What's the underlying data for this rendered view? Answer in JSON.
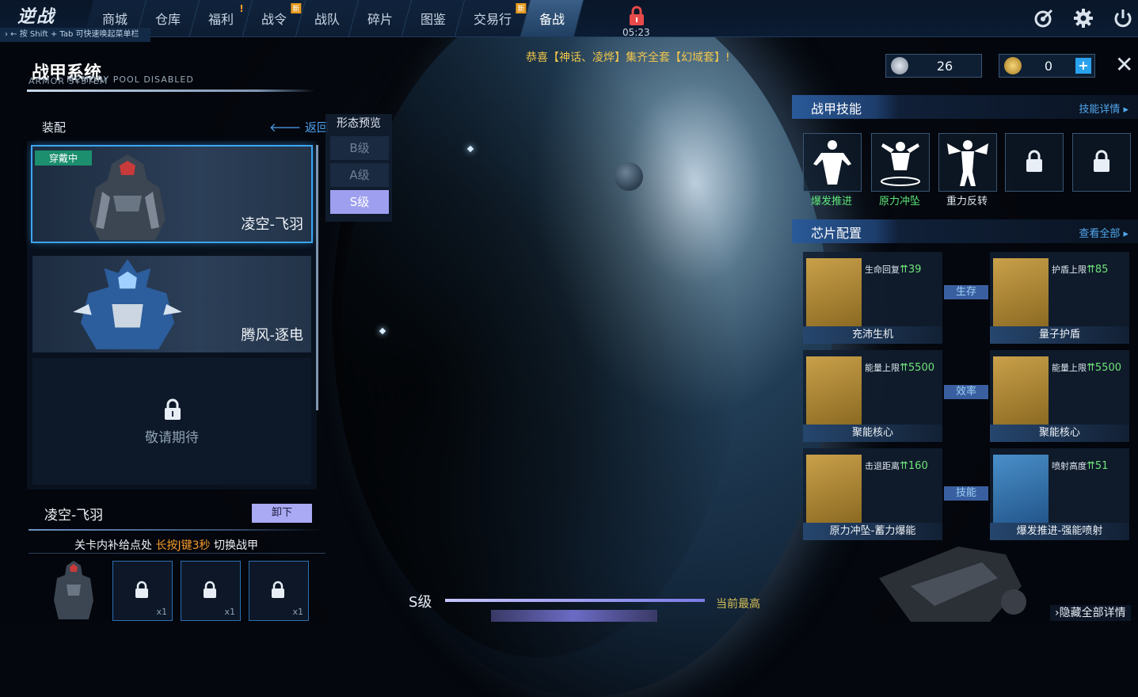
{
  "topbar": {
    "logo": "逆战",
    "nav": [
      {
        "label": "商城",
        "badge": ""
      },
      {
        "label": "仓库",
        "badge": ""
      },
      {
        "label": "福利",
        "badge": "!"
      },
      {
        "label": "战令",
        "badge": "新"
      },
      {
        "label": "战队",
        "badge": ""
      },
      {
        "label": "碎片",
        "badge": ""
      },
      {
        "label": "图鉴",
        "badge": ""
      },
      {
        "label": "交易行",
        "badge": "新"
      },
      {
        "label": "备战",
        "badge": ""
      }
    ],
    "hint": "›  ← 按 Shift + Tab 可快速唤起菜单栏",
    "timer": "05:23",
    "icons": [
      "target-icon",
      "gear-icon",
      "power-icon"
    ]
  },
  "announcement": "恭喜【神话、凌烨】集齐全套【幻域套】!",
  "currencies": [
    {
      "icon": "silver-coin-icon",
      "value": "26"
    },
    {
      "icon": "gold-coin-icon",
      "value": "0",
      "plus": "+"
    }
  ],
  "left": {
    "title": "战甲系统",
    "subtitle": "ARMOR SYSTEM",
    "overlay_text": "MEMORY POOL DISABLED",
    "equip_label": "装配",
    "back_label": "返回",
    "armors": [
      {
        "name": "凌空-飞羽",
        "wearing": "穿戴中"
      },
      {
        "name": "腾风-逐电"
      }
    ],
    "locked_text": "敬请期待",
    "current_armor": "凌空-飞羽",
    "unequip_label": "卸下",
    "tip_prefix": "关卡内补给点处 ",
    "tip_highlight": "长按J键3秒",
    "tip_suffix": " 切换战甲",
    "slots": [
      {
        "count": "x1"
      },
      {
        "count": "x1"
      },
      {
        "count": "x1"
      }
    ]
  },
  "preview": {
    "title": "形态预览",
    "grades": [
      "B级",
      "A级",
      "S级"
    ],
    "selected": "S级"
  },
  "grade_bar": {
    "label": "S级",
    "status": "当前最高",
    "progress": 1.0
  },
  "skills": {
    "title": "战甲技能",
    "link": "技能详情",
    "items": [
      {
        "name": "爆发推进",
        "color": "#5ee87a"
      },
      {
        "name": "原力冲坠",
        "color": "#5ee87a"
      },
      {
        "name": "重力反转",
        "color": "#dfe8f2"
      },
      {
        "name": "",
        "locked": true
      },
      {
        "name": "",
        "locked": true
      }
    ]
  },
  "chips": {
    "title": "芯片配置",
    "link": "查看全部",
    "items": [
      {
        "stat": "生命回复",
        "value": "39",
        "name": "充沛生机"
      },
      {
        "stat": "护盾上限",
        "value": "85",
        "name": "量子护盾"
      },
      {
        "stat": "能量上限",
        "value": "5500",
        "name": "聚能核心"
      },
      {
        "stat": "能量上限",
        "value": "5500",
        "name": "聚能核心"
      },
      {
        "stat": "击退距离",
        "value": "160",
        "name": "原力冲坠-蓄力爆能"
      },
      {
        "stat": "喷射高度",
        "value": "51",
        "name": "爆发推进-强能喷射"
      }
    ],
    "connectors": [
      "生存",
      "效率",
      "技能"
    ]
  },
  "hide_all": "›隐藏全部详情"
}
